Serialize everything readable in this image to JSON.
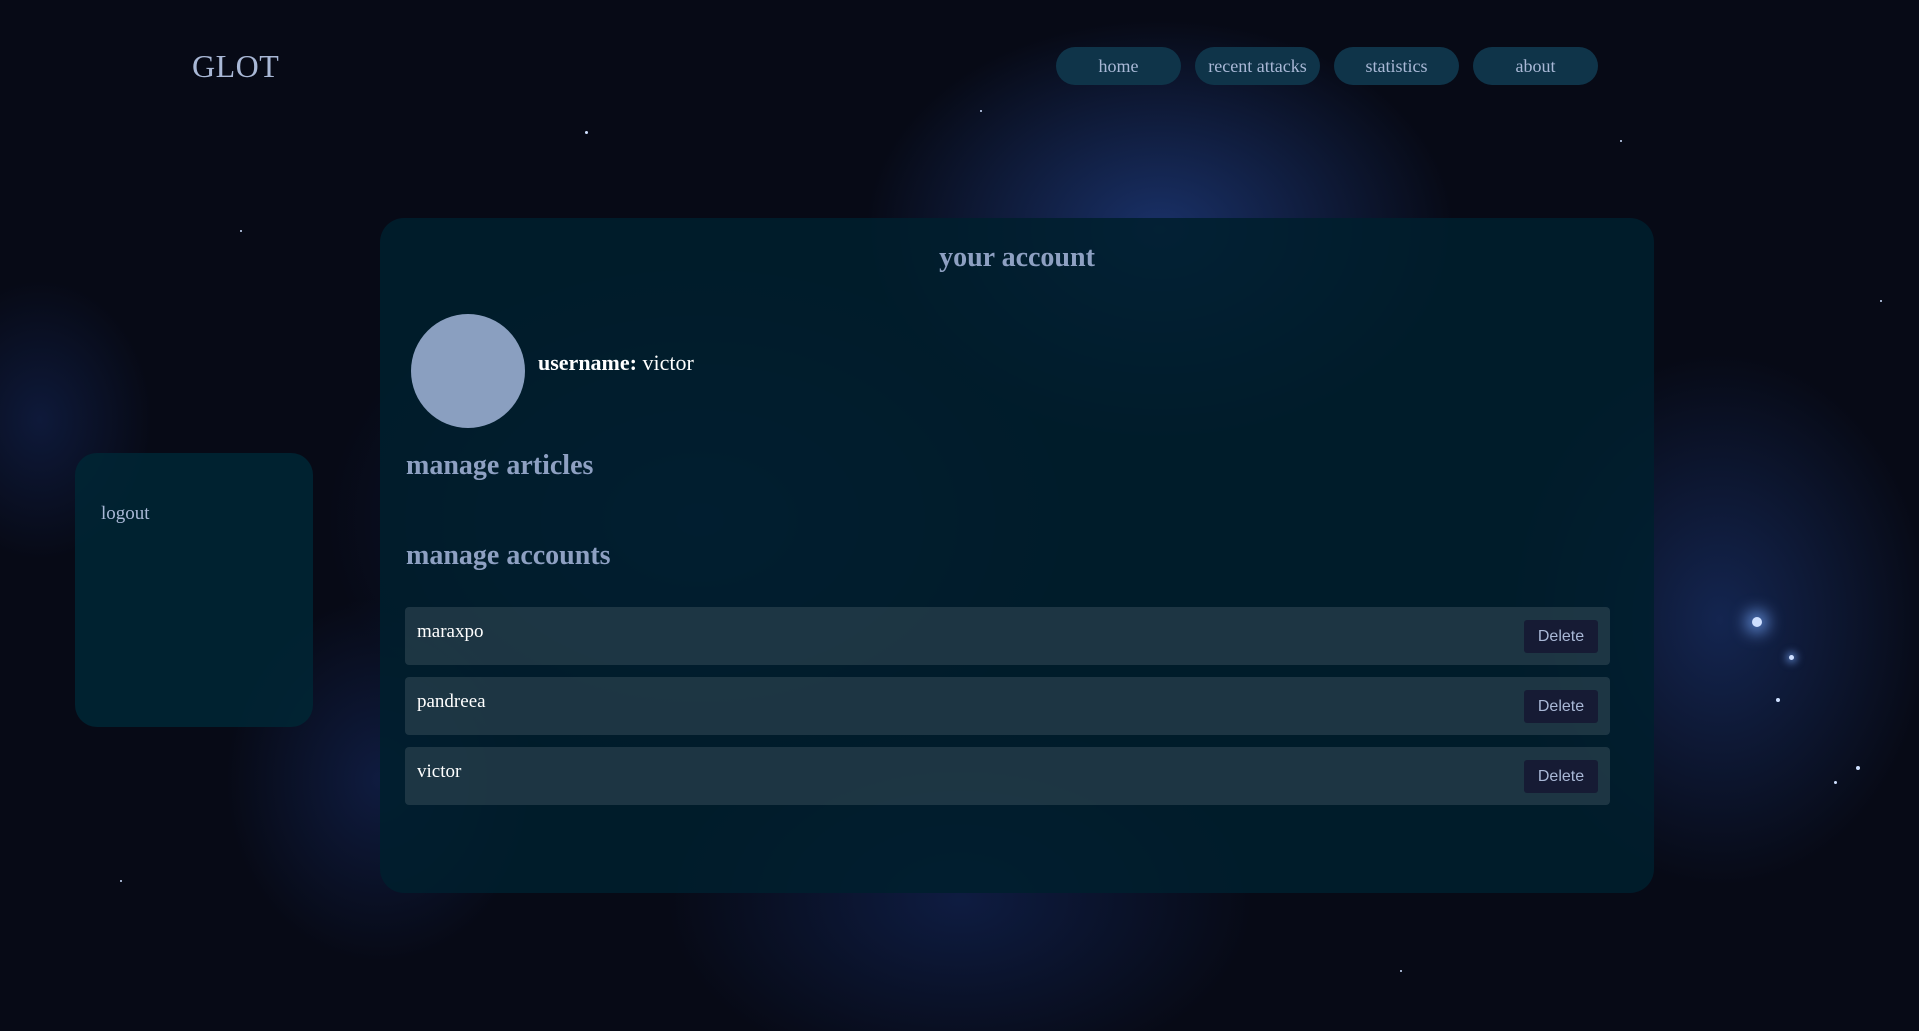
{
  "brand": {
    "logo": "GLOT"
  },
  "nav": {
    "items": [
      {
        "label": "home"
      },
      {
        "label": "recent attacks"
      },
      {
        "label": "statistics"
      },
      {
        "label": "about"
      }
    ]
  },
  "sidebar": {
    "logout_label": "logout"
  },
  "account": {
    "title": "your account",
    "username_label": "username:",
    "username_value": "victor",
    "manage_articles_heading": "manage articles",
    "manage_accounts_heading": "manage accounts",
    "accounts": [
      {
        "name": "maraxpo",
        "action_label": "Delete"
      },
      {
        "name": "pandreea",
        "action_label": "Delete"
      },
      {
        "name": "victor",
        "action_label": "Delete"
      }
    ]
  },
  "colors": {
    "background": "#070a16",
    "panel": "#001f2d",
    "nav_button": "#0f3449",
    "heading": "#8ea0c2",
    "avatar": "#8a9fc0",
    "delete_button": "#161b34"
  }
}
